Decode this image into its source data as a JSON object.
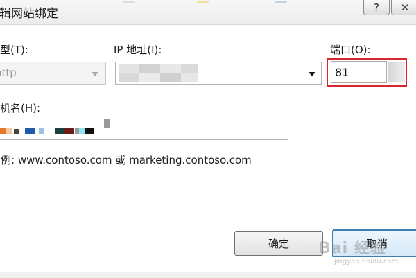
{
  "dialog": {
    "title": "编辑网站绑定",
    "help_label": "?",
    "close_label": "✕"
  },
  "form": {
    "type_label": "类型(T):",
    "type_value": "http",
    "ip_label": "IP 地址(I):",
    "port_label": "端口(O):",
    "port_value": "81",
    "host_label": "主机名(H):",
    "example": "示例: www.contoso.com 或 marketing.contoso.com"
  },
  "buttons": {
    "ok_label": "确定",
    "cancel_label": "取消"
  },
  "watermark": {
    "text": "Bai 经验",
    "sub": "jingyan.baidu.com"
  },
  "colors": {
    "highlight": "#d9262c",
    "focus": "#3c7fb1"
  },
  "icons": {
    "dropdown": "chevron-down-icon"
  }
}
